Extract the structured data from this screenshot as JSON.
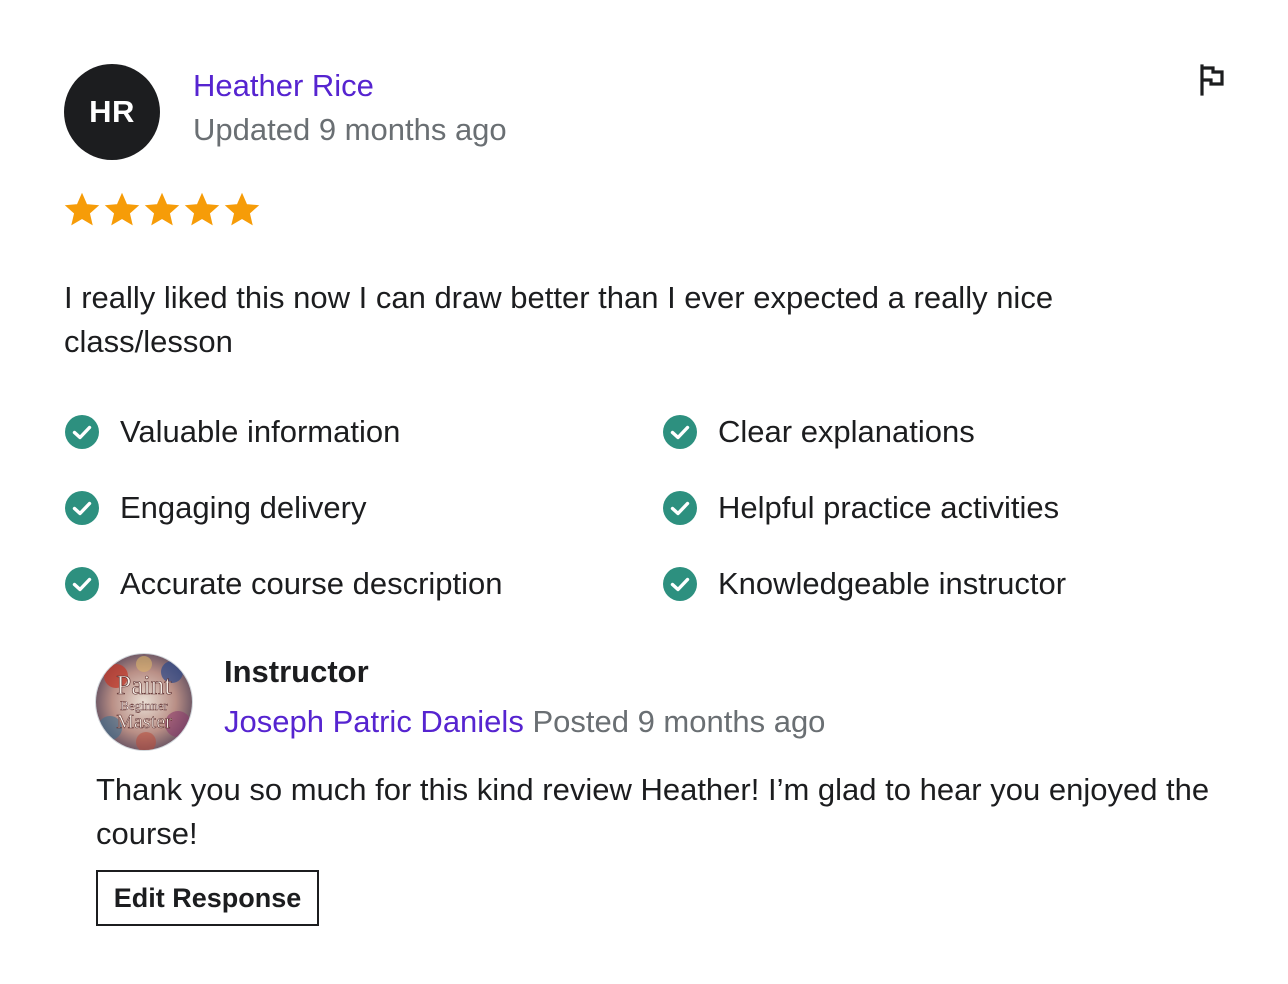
{
  "review": {
    "avatar_initials": "HR",
    "avatar_color": "#1c1d1f",
    "reviewer_name": "Heather Rice",
    "updated": "Updated 9 months ago",
    "rating": 5,
    "rating_max": 5,
    "star_color": "#f69c08",
    "text": "I really liked this now I can draw better than I ever expected a really nice class/lesson",
    "flag_icon": "flag-icon"
  },
  "features": {
    "check_color": "#2d907f",
    "items": [
      "Valuable information",
      "Clear explanations",
      "Engaging delivery",
      "Helpful practice activities",
      "Accurate course description",
      "Knowledgeable instructor"
    ]
  },
  "response": {
    "role": "Instructor",
    "instructor_name": "Joseph Patric Daniels",
    "posted": "Posted 9 months ago",
    "avatar_logo_lines": [
      "Paint",
      "Beginner",
      "Master"
    ],
    "text": "Thank you so much for this kind review Heather! I’m glad to hear you enjoyed the course!",
    "edit_button_label": "Edit Response"
  },
  "colors": {
    "link": "#5624d0",
    "muted": "#6a6f73",
    "text": "#1c1d1f"
  }
}
